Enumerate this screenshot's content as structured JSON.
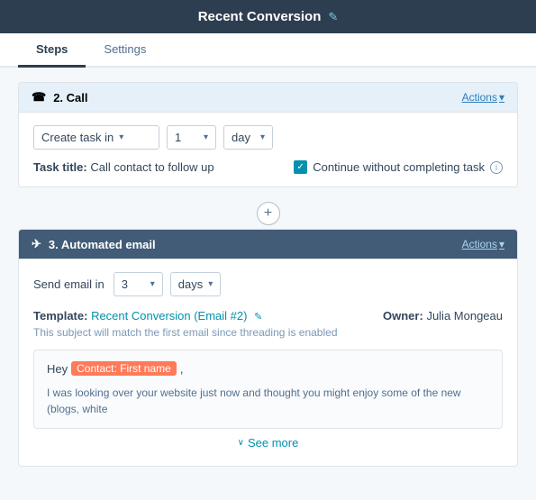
{
  "header": {
    "title": "Recent Conversion",
    "edit_icon": "✎"
  },
  "tabs": [
    {
      "id": "steps",
      "label": "Steps",
      "active": true
    },
    {
      "id": "settings",
      "label": "Settings",
      "active": false
    }
  ],
  "step2": {
    "icon": "📞",
    "label": "2. Call",
    "actions_label": "Actions",
    "dropdown_create": "Create task in",
    "dropdown_num": "1",
    "dropdown_unit": "day",
    "task_title_label": "Task title:",
    "task_title_value": "Call contact to follow up",
    "continue_label": "Continue without completing task"
  },
  "connector": {
    "plus": "+"
  },
  "step3": {
    "icon": "✈",
    "label": "3. Automated email",
    "actions_label": "Actions",
    "send_label": "Send email in",
    "send_num": "3",
    "send_unit": "days",
    "template_label": "Template:",
    "template_link": "Recent Conversion (Email #2)",
    "owner_label": "Owner:",
    "owner_value": "Julia Mongeau",
    "threading_note": "This subject will match the first email since threading is enabled",
    "email_hey": "Hey",
    "contact_tag": "Contact: First name",
    "email_comma": ",",
    "email_body": "I was looking over your website just now and thought you might enjoy some of the new (blogs, white",
    "see_more": "See more"
  }
}
